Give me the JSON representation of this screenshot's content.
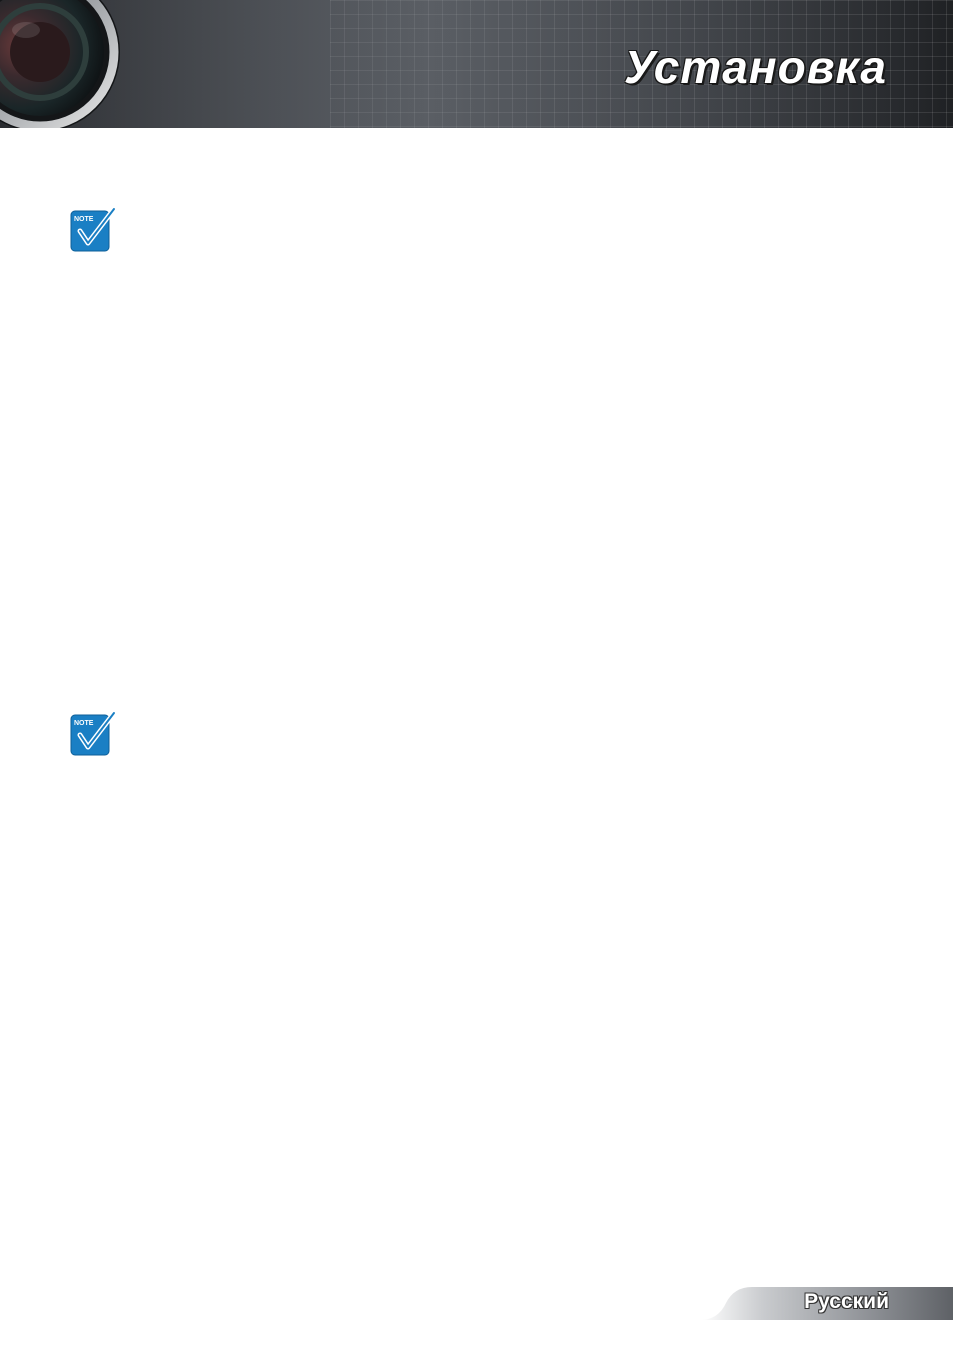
{
  "header": {
    "title": "Установка"
  },
  "notes": [
    {
      "label": "Note",
      "icon": "note-check-icon"
    },
    {
      "label": "Note",
      "icon": "note-check-icon"
    }
  ],
  "footer": {
    "language": "Русский"
  },
  "colors": {
    "note_blue": "#1a7fc4",
    "footer_gray": "#8a8d92"
  }
}
